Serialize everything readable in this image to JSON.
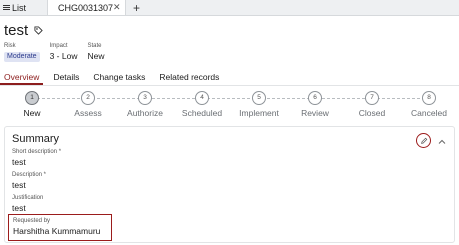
{
  "tabs": {
    "list_label": "List",
    "active_label": "CHG0031307",
    "close_glyph": "✕",
    "add_glyph": "+"
  },
  "header": {
    "title": "test",
    "risk_label": "Risk",
    "risk_value": "Moderate",
    "impact_label": "Impact",
    "impact_value": "3 - Low",
    "state_label": "State",
    "state_value": "New"
  },
  "subtabs": [
    "Overview",
    "Details",
    "Change tasks",
    "Related records"
  ],
  "stepper": {
    "steps": [
      {
        "num": "1",
        "label": "New"
      },
      {
        "num": "2",
        "label": "Assess"
      },
      {
        "num": "3",
        "label": "Authorize"
      },
      {
        "num": "4",
        "label": "Scheduled"
      },
      {
        "num": "5",
        "label": "Implement"
      },
      {
        "num": "6",
        "label": "Review"
      },
      {
        "num": "7",
        "label": "Closed"
      },
      {
        "num": "8",
        "label": "Canceled"
      }
    ],
    "current_step": 1
  },
  "summary": {
    "title": "Summary",
    "short_description_label": "Short description *",
    "short_description_value": "test",
    "description_label": "Description *",
    "description_value": "test",
    "justification_label": "Justification",
    "justification_value": "test",
    "requested_by_label": "Requested by",
    "requested_by_value": "Harshitha Kummamuru"
  },
  "colors": {
    "accent": "#8c1d1d",
    "highlight_border": "#9b1c1c",
    "risk_badge_bg": "#dfe3f3",
    "tabbar_bg": "#eef0f2"
  },
  "icons": {
    "list": "list-icon",
    "tag": "tag-icon",
    "edit": "pencil-icon",
    "collapse": "chevron-up-icon",
    "close": "close-icon",
    "add": "plus-icon"
  }
}
